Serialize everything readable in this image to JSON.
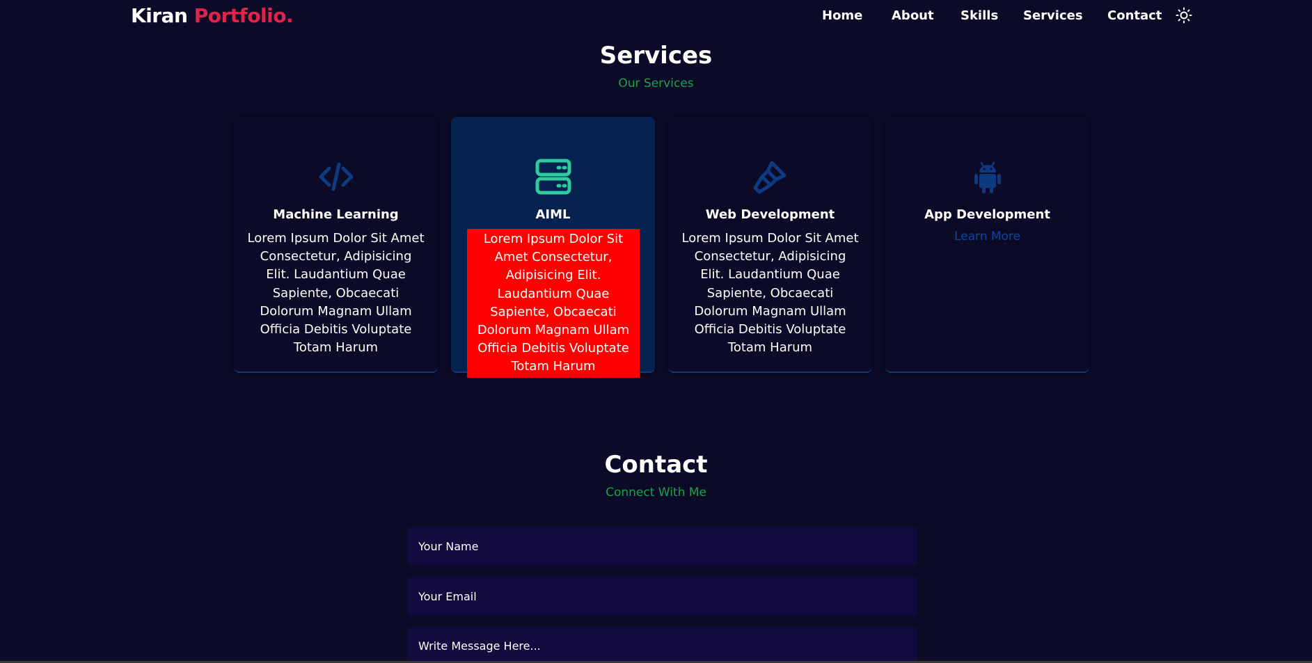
{
  "nav": {
    "logo_first": "Kiran",
    "logo_accent": "Portfolio.",
    "links": [
      "Home",
      "About",
      "Skills",
      "Services",
      "Contact"
    ],
    "theme_icon": "sun-icon"
  },
  "services": {
    "title": "Services",
    "subtitle": "Our Services",
    "cards": [
      {
        "icon": "code-icon",
        "title": "Machine Learning",
        "text": "Lorem Ipsum Dolor Sit Amet Consectetur, Adipisicing Elit. Laudantium Quae Sapiente, Obcaecati Dolorum Magnam Ullam Officia Debitis Voluptate Totam Harum"
      },
      {
        "icon": "server-icon",
        "title": "AIML",
        "text": "Lorem Ipsum Dolor Sit Amet Consectetur, Adipisicing Elit. Laudantium Quae Sapiente, Obcaecati Dolorum Magnam Ullam Officia Debitis Voluptate Totam Harum"
      },
      {
        "icon": "paint-brush-icon",
        "title": "Web Development",
        "text": "Lorem Ipsum Dolor Sit Amet Consectetur, Adipisicing Elit. Laudantium Quae Sapiente, Obcaecati Dolorum Magnam Ullam Officia Debitis Voluptate Totam Harum"
      },
      {
        "icon": "android-icon",
        "title": "App Development",
        "link": "Learn More"
      }
    ]
  },
  "contact": {
    "title": "Contact",
    "subtitle": "Connect With Me",
    "name_placeholder": "Your Name",
    "email_placeholder": "Your Email",
    "message_placeholder": "Write Message Here..."
  },
  "colors": {
    "background": "#0c0b27",
    "logo_accent": "#e2234a",
    "subtitle_green": "#16a34a",
    "active_card": "#04214f",
    "highlight_red": "#ff0000",
    "icon_blue": "#0d3a80",
    "icon_green": "#2ecc9a",
    "link_blue": "#0d47a1",
    "input_bg": "#130a3d"
  }
}
